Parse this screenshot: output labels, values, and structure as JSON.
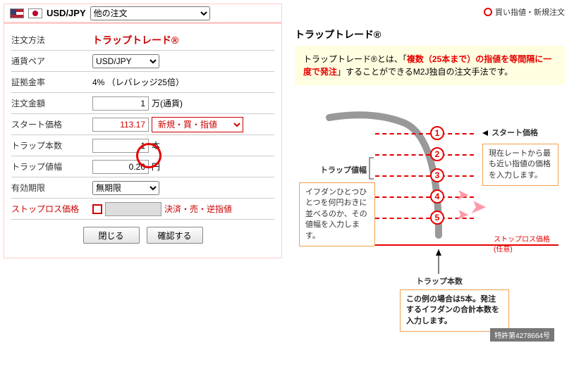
{
  "header": {
    "pair": "USD/JPY",
    "other_orders": "他の注文"
  },
  "form": {
    "title": "トラップトレード®",
    "labels": {
      "method": "注文方法",
      "pair": "通貨ペア",
      "margin": "証拠金率",
      "amount": "注文金額",
      "start": "スタート価格",
      "count": "トラップ本数",
      "width": "トラップ値幅",
      "expiry": "有効期限",
      "stoploss": "ストップロス価格"
    },
    "values": {
      "pair": "USD/JPY",
      "margin": "4%  （レバレッジ25倍）",
      "amount": "1",
      "amount_unit": "万(通貨)",
      "start": "113.17",
      "order_kind": "新規・買・指値",
      "count": "1",
      "count_unit": "本",
      "width": "0.20",
      "width_unit": "円",
      "expiry": "無期限",
      "stoploss": "",
      "sl_kind": "決済・売・逆指値"
    },
    "buttons": {
      "close": "閉じる",
      "confirm": "確認する"
    }
  },
  "right": {
    "legend": "買い指値・新規注文",
    "title": "トラップトレード®",
    "explain_prefix": "トラップトレード®とは、「",
    "explain_red": "複数（25本まで）の指値を等間隔に一度で発注",
    "explain_suffix": "」することができるM2J独自の注文手法です。",
    "start_label": "スタート価格",
    "start_note": "現在レートから最も近い指値の価格を入力します。",
    "width_label": "トラップ値幅",
    "width_note": "イフダンひとつひとつを何円おきに並べるのか、その値幅を入力します。",
    "sl_label": "ストップロス価格(任意)",
    "count_label": "トラップ本数",
    "count_note": "この例の場合は5本。発注するイフダンの合計本数を入力します。",
    "patent": "特許第4278664号",
    "nums": {
      "1": "1",
      "2": "2",
      "3": "3",
      "4": "4",
      "5": "5"
    }
  }
}
